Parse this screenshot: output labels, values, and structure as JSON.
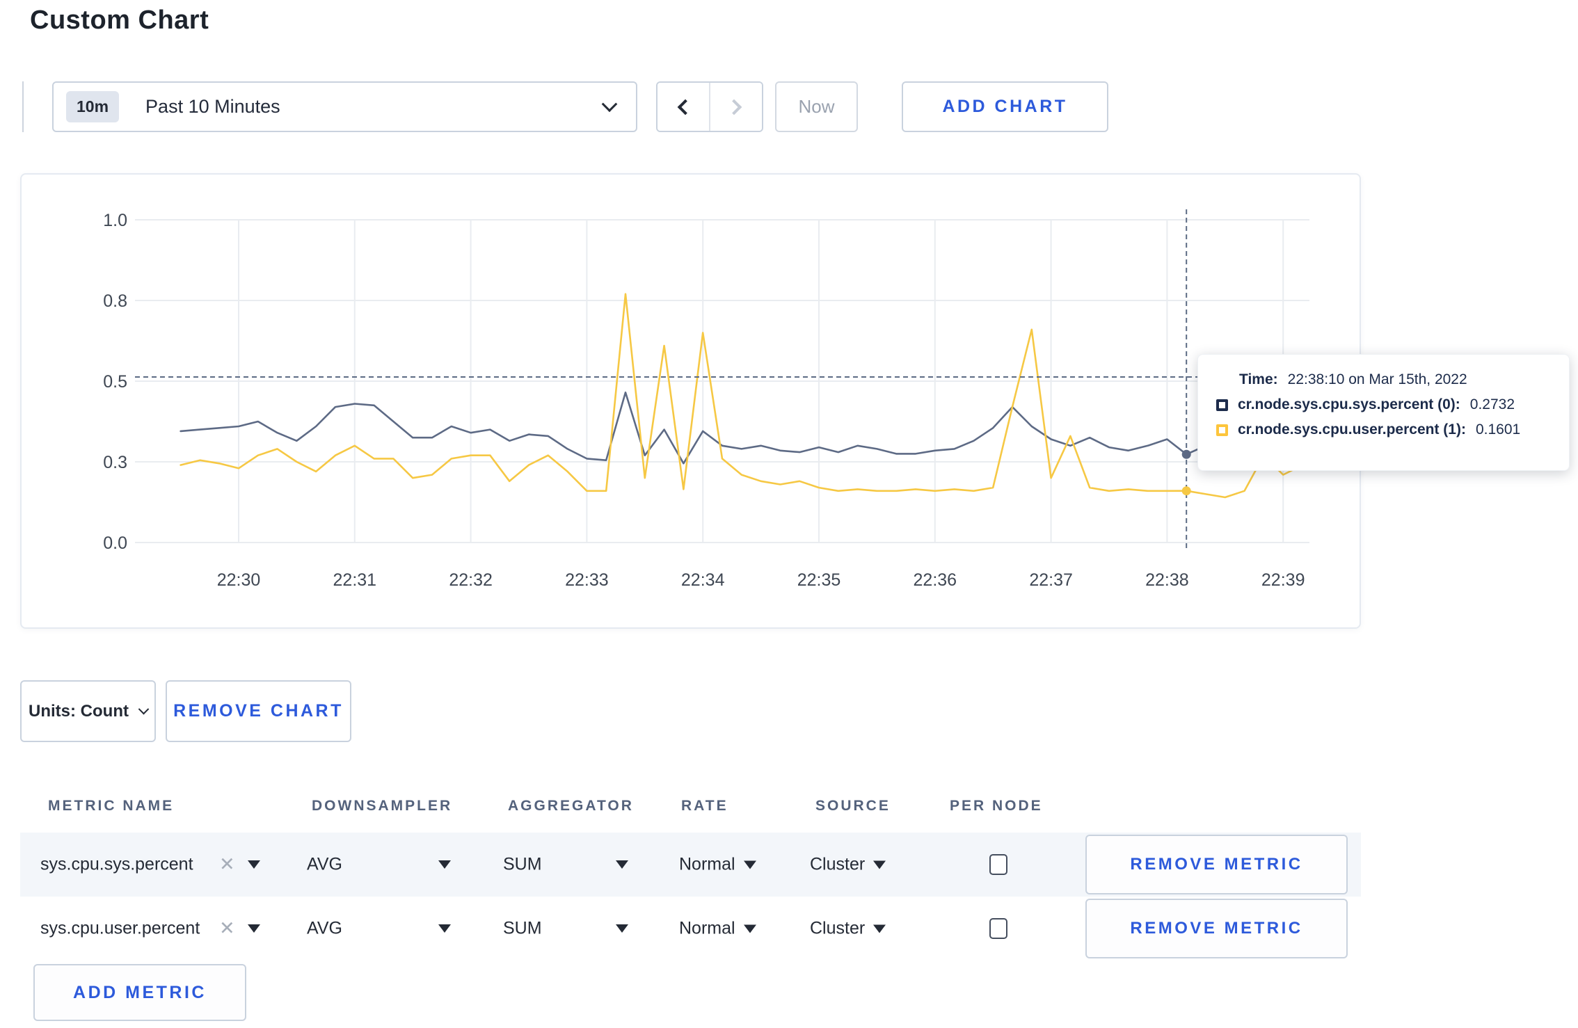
{
  "page": {
    "title": "Custom Chart"
  },
  "toolbar": {
    "range_badge": "10m",
    "range_label": "Past 10 Minutes",
    "now_label": "Now",
    "add_chart_label": "ADD CHART"
  },
  "chart_controls": {
    "units_label": "Units: Count",
    "remove_chart_label": "REMOVE CHART"
  },
  "tooltip": {
    "time_label": "Time:",
    "time_value": "22:38:10 on Mar 15th, 2022",
    "series": [
      {
        "name": "cr.node.sys.cpu.sys.percent (0):",
        "value": "0.2732",
        "color": "#1d2c4c"
      },
      {
        "name": "cr.node.sys.cpu.user.percent (1):",
        "value": "0.1601",
        "color": "#fdc53c"
      }
    ]
  },
  "chart_data": {
    "type": "line",
    "title": "",
    "xlabel": "",
    "ylabel": "",
    "ylim": [
      0,
      1
    ],
    "grid": true,
    "x_ticks": [
      "22:30",
      "22:31",
      "22:32",
      "22:33",
      "22:34",
      "22:35",
      "22:36",
      "22:37",
      "22:38",
      "22:39"
    ],
    "y_tick_labels": [
      "0.0",
      "0.3",
      "0.5",
      "0.8",
      "1.0"
    ],
    "y_tick_values": [
      0,
      0.25,
      0.5,
      0.75,
      1.0
    ],
    "x_start": "22:29:30",
    "x_step_seconds": 10,
    "series": [
      {
        "name": "cr.node.sys.cpu.sys.percent",
        "color": "#5d6a85",
        "values": [
          0.345,
          0.35,
          0.355,
          0.36,
          0.375,
          0.34,
          0.315,
          0.36,
          0.42,
          0.43,
          0.425,
          0.375,
          0.325,
          0.325,
          0.36,
          0.34,
          0.35,
          0.315,
          0.335,
          0.33,
          0.29,
          0.26,
          0.255,
          0.465,
          0.27,
          0.35,
          0.245,
          0.345,
          0.3,
          0.29,
          0.3,
          0.285,
          0.28,
          0.295,
          0.28,
          0.3,
          0.29,
          0.275,
          0.275,
          0.285,
          0.29,
          0.315,
          0.355,
          0.42,
          0.36,
          0.32,
          0.3,
          0.325,
          0.295,
          0.285,
          0.3,
          0.32,
          0.2732,
          0.3,
          0.31,
          0.3,
          0.295,
          0.3,
          0.31
        ]
      },
      {
        "name": "cr.node.sys.cpu.user.percent",
        "color": "#f6c844",
        "values": [
          0.24,
          0.255,
          0.245,
          0.23,
          0.27,
          0.29,
          0.25,
          0.22,
          0.27,
          0.3,
          0.26,
          0.26,
          0.2,
          0.21,
          0.26,
          0.27,
          0.27,
          0.19,
          0.24,
          0.27,
          0.22,
          0.16,
          0.16,
          0.77,
          0.2,
          0.61,
          0.165,
          0.65,
          0.26,
          0.21,
          0.19,
          0.18,
          0.19,
          0.17,
          0.16,
          0.165,
          0.16,
          0.16,
          0.165,
          0.16,
          0.165,
          0.16,
          0.17,
          0.42,
          0.66,
          0.2,
          0.33,
          0.17,
          0.16,
          0.165,
          0.16,
          0.16,
          0.1601,
          0.15,
          0.14,
          0.16,
          0.27,
          0.21,
          0.24
        ]
      }
    ],
    "crosshair": {
      "time": "22:38:10",
      "y_value": 0.513
    },
    "hover_points": [
      {
        "series": 0,
        "value": 0.2732
      },
      {
        "series": 1,
        "value": 0.1601
      }
    ],
    "legend_position": "tooltip"
  },
  "metrics_table": {
    "headers": [
      "METRIC NAME",
      "DOWNSAMPLER",
      "AGGREGATOR",
      "RATE",
      "SOURCE",
      "PER NODE"
    ],
    "rows": [
      {
        "metric_name": "sys.cpu.sys.percent",
        "downsampler": "AVG",
        "aggregator": "SUM",
        "rate": "Normal",
        "source": "Cluster",
        "per_node_checked": false,
        "remove_label": "REMOVE METRIC"
      },
      {
        "metric_name": "sys.cpu.user.percent",
        "downsampler": "AVG",
        "aggregator": "SUM",
        "rate": "Normal",
        "source": "Cluster",
        "per_node_checked": false,
        "remove_label": "REMOVE METRIC"
      }
    ],
    "add_metric_label": "ADD METRIC"
  }
}
